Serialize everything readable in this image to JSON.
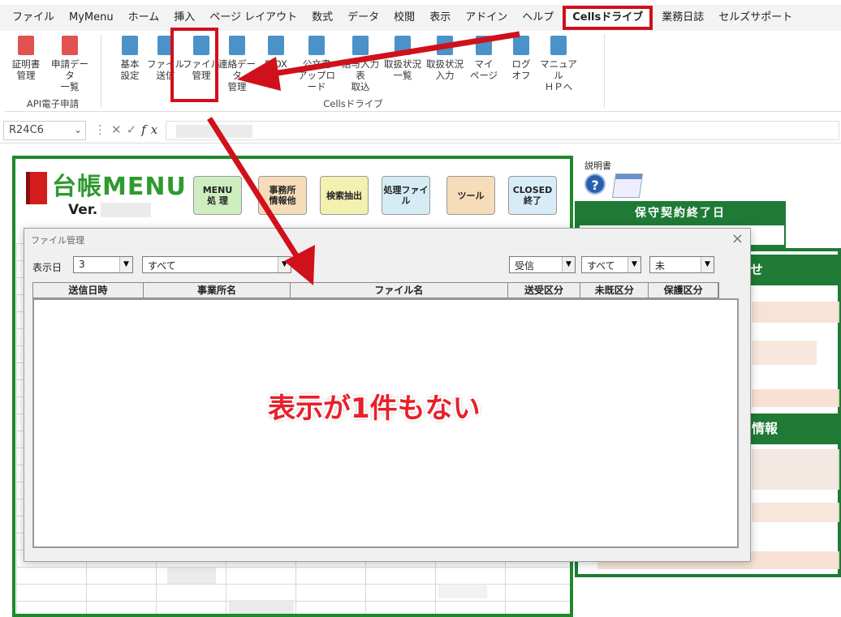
{
  "menubar": {
    "items": [
      "ファイル",
      "MyMenu",
      "ホーム",
      "挿入",
      "ページ レイアウト",
      "数式",
      "データ",
      "校閲",
      "表示",
      "アドイン",
      "ヘルプ",
      "Cellsドライブ",
      "業務日誌",
      "セルズサポート"
    ],
    "active_index": 11
  },
  "ribbon": {
    "groups": [
      {
        "label": "API電子申請",
        "buttons": [
          {
            "l1": "証明書",
            "l2": "管理",
            "icon": "certificate-icon"
          },
          {
            "l1": "申請データ",
            "l2": "一覧",
            "icon": "application-list-icon"
          }
        ]
      },
      {
        "label": "Cellsドライブ",
        "buttons": [
          {
            "l1": "基本",
            "l2": "設定",
            "icon": "gear-icon"
          },
          {
            "l1": "ファイル",
            "l2": "送信",
            "icon": "send-icon"
          },
          {
            "l1": "ファイル",
            "l2": "管理",
            "icon": "file-manage-icon"
          },
          {
            "l1": "連絡データ",
            "l2": "管理",
            "icon": "contact-icon"
          },
          {
            "l1": "",
            "l2": "B OX",
            "icon": "box-icon"
          },
          {
            "l1": "公文書",
            "l2": "アップロード",
            "icon": "upload-icon"
          },
          {
            "l1": "給与入力表",
            "l2": "取込",
            "icon": "import-icon"
          },
          {
            "l1": "取扱状況",
            "l2": "一覧",
            "icon": "status-list-icon"
          },
          {
            "l1": "取扱状況",
            "l2": "入力",
            "icon": "status-input-icon"
          },
          {
            "l1": "マイ",
            "l2": "ページ",
            "icon": "home-icon"
          },
          {
            "l1": "ログ",
            "l2": "オフ",
            "icon": "key-icon"
          },
          {
            "l1": "マニュアル",
            "l2": "ＨＰへ",
            "icon": "help-icon"
          }
        ]
      }
    ]
  },
  "formula_bar": {
    "name_box": "R24C6",
    "fx": "fx"
  },
  "sheet": {
    "logo_text": "台帳MENU",
    "ver_label": "Ver.",
    "menu_buttons": [
      {
        "label": "MENU\n処 理",
        "name": "menu-process-button",
        "color": "#cfeec0"
      },
      {
        "label": "事務所\n情報他",
        "name": "office-info-button",
        "color": "#f6dcb8"
      },
      {
        "label": "検索抽出",
        "name": "search-extract-button",
        "color": "#f4f0b0"
      },
      {
        "label": "処理ファイル",
        "name": "processed-file-button",
        "color": "#d6ecf4"
      },
      {
        "label": "ツール",
        "name": "tool-button",
        "color": "#f6dcb8"
      },
      {
        "label": "CLOSED\n終了",
        "name": "closed-button",
        "color": "#d8ecf8"
      }
    ],
    "manual_label": "説明書",
    "contract_end_title": "保守契約終了日",
    "notice_partial": "せ",
    "info_partial": "情報"
  },
  "dialog": {
    "title": "ファイル管理",
    "display_days_label": "表示日",
    "display_days_value": "3",
    "office_filter": "すべて",
    "direction_filter": "受信",
    "status_filter": "すべて",
    "saved_filter": "未",
    "columns": [
      "送信日時",
      "事業所名",
      "ファイル名",
      "送受区分",
      "未既区分",
      "保護区分"
    ],
    "empty_message": "表示が1件もない"
  },
  "colors": {
    "accent_red": "#d0101b",
    "brand_green": "#1e8a2a"
  }
}
